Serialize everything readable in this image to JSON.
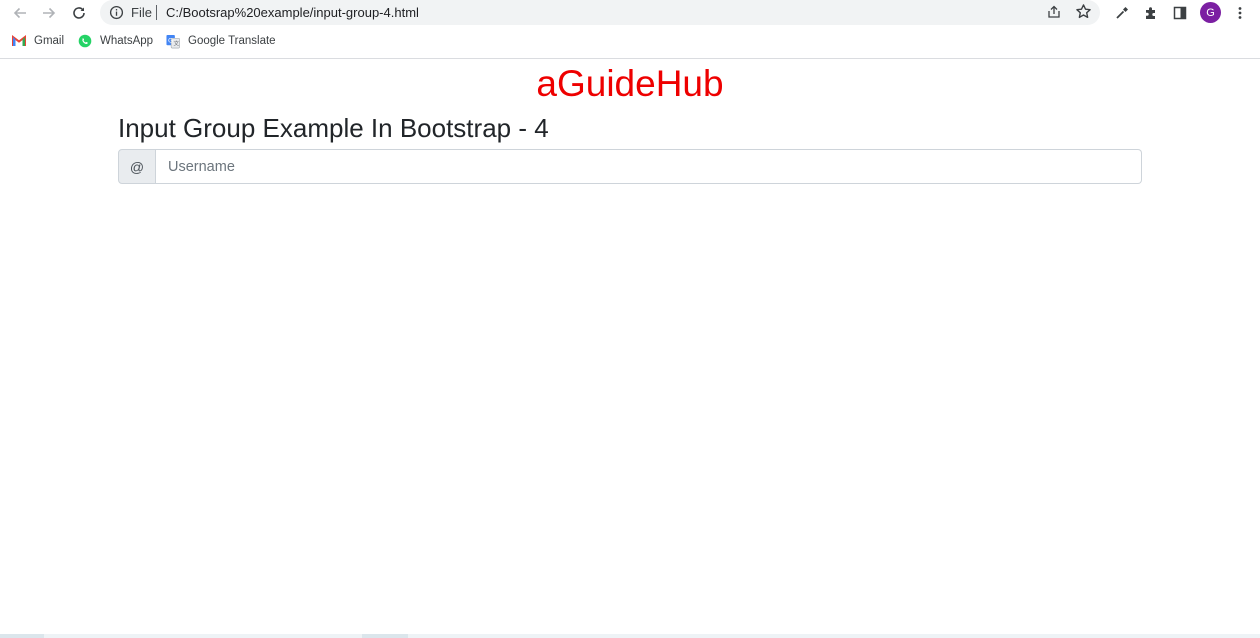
{
  "browser": {
    "site_label": "File",
    "url": "C:/Bootsrap%20example/input-group-4.html",
    "avatar_letter": "G",
    "avatar_color": "#7b1fa2",
    "icons": [
      "back-arrow-icon",
      "forward-arrow-icon",
      "reload-icon",
      "info-icon",
      "share-icon",
      "star-icon",
      "eyedropper-icon",
      "extensions-puzzle-icon",
      "side-panel-icon",
      "kebab-menu-icon"
    ]
  },
  "bookmarks": [
    {
      "label": "Gmail",
      "icon": "gmail-icon"
    },
    {
      "label": "WhatsApp",
      "icon": "whatsapp-icon"
    },
    {
      "label": "Google Translate",
      "icon": "google-translate-icon"
    }
  ],
  "page": {
    "brand_title": "aGuideHub",
    "brand_color": "#ee0000",
    "heading": "Input Group Example In Bootstrap - 4",
    "input_group": {
      "addon": "@",
      "placeholder": "Username",
      "value": ""
    }
  }
}
